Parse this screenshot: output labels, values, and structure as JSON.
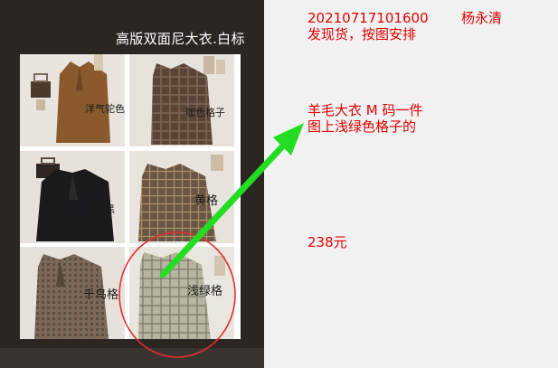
{
  "image_panel": {
    "title": "高版双面尼大衣.白标",
    "cells": [
      {
        "label": "洋气驼色"
      },
      {
        "label": "咖色格子"
      },
      {
        "label": "百搭黑"
      },
      {
        "label": "黄格"
      },
      {
        "label": "千鸟格"
      },
      {
        "label": "浅绿格"
      }
    ]
  },
  "note": {
    "order_no": "20210717101600",
    "customer": "杨永清",
    "line2": "发现货，按图安排",
    "line3": "羊毛大衣 M 码一件",
    "line4": "图上浅绿色格子的",
    "price": "238元"
  },
  "colors": {
    "note_text": "#e00000",
    "arrow": "#22dd22",
    "circle": "#e03030",
    "panel_bg": "#2c2623"
  }
}
